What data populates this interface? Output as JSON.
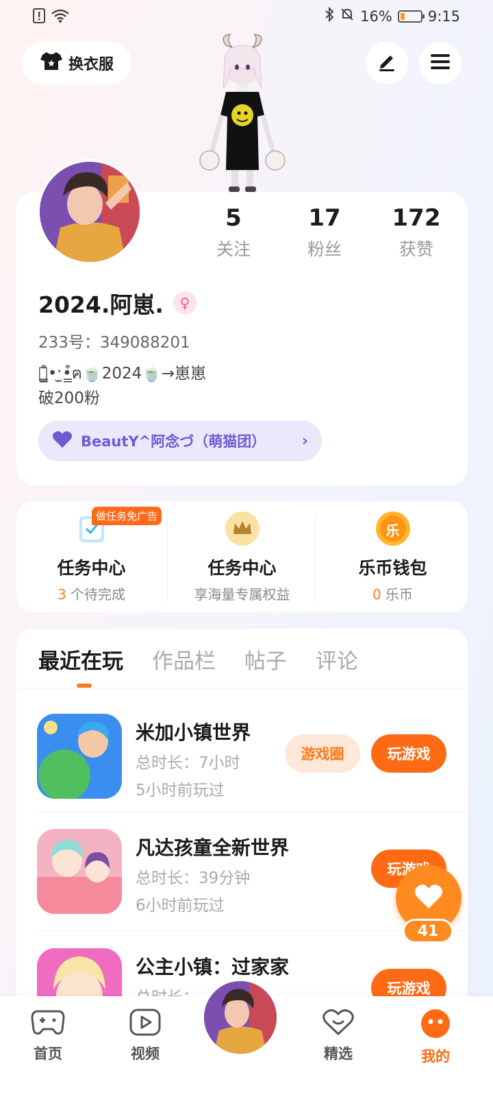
{
  "status_bar": {
    "battery": "16%",
    "time": "9:15"
  },
  "header": {
    "outfit_label": "换衣服"
  },
  "profile": {
    "stats": [
      {
        "num": "5",
        "label": "关注"
      },
      {
        "num": "17",
        "label": "粉丝"
      },
      {
        "num": "172",
        "label": "获赞"
      }
    ],
    "username": "2024.阿崽.",
    "gender_symbol": "♀",
    "uid": "233号：349088201",
    "bio_line1": "ฅ̳͒•ˑ̫•̳͒ฅ🍵2024🍵→崽崽",
    "bio_line2": "破200粉",
    "group_name": "BeautY^阿念づ（萌猫团）"
  },
  "tasks": {
    "ad_tag": "做任务免广告",
    "items": [
      {
        "title": "任务中心",
        "num": "3",
        "sub": " 个待完成"
      },
      {
        "title": "任务中心",
        "num": "",
        "sub": "享海量专属权益"
      },
      {
        "title": "乐币钱包",
        "num": "0",
        "sub": " 乐币"
      }
    ],
    "coin_glyph": "乐"
  },
  "tabs": [
    "最近在玩",
    "作品栏",
    "帖子",
    "评论"
  ],
  "games": [
    {
      "name": "米加小镇世界",
      "duration": "总时长：7小时",
      "last_played": "5小时前玩过",
      "circle_label": "游戏圈",
      "play_label": "玩游戏"
    },
    {
      "name": "凡达孩童全新世界",
      "duration": "总时长：39分钟",
      "last_played": "6小时前玩过",
      "play_label": "玩游戏"
    },
    {
      "name": "公主小镇：过家家",
      "duration": "总时长：",
      "play_label": "玩游戏"
    }
  ],
  "float_like": {
    "count": "41"
  },
  "bottom_nav": [
    {
      "label": "首页"
    },
    {
      "label": "视频"
    },
    {
      "label": "精选"
    },
    {
      "label": "我的"
    }
  ],
  "colors": {
    "accent": "#ff6a14",
    "group_purple": "#6e5bd4"
  }
}
